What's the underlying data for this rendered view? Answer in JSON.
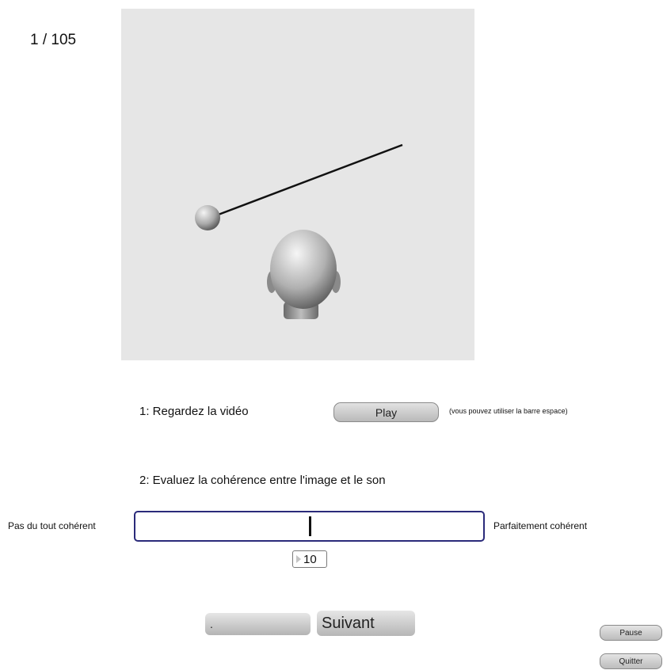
{
  "header": {
    "counter": "1 / 105"
  },
  "steps": {
    "step1_label": "1: Regardez la vidéo",
    "play_label": "Play",
    "play_hint": "(vous pouvez utiliser la barre espace)",
    "step2_label": "2: Evaluez la cohérence entre l'image et le son"
  },
  "rating": {
    "left_label": "Pas du tout cohérent",
    "right_label": "Parfaitement cohérent",
    "value": "10",
    "slider_level": 0.5
  },
  "navigation": {
    "previous_label": ".",
    "next_label": "Suivant"
  },
  "controls": {
    "pause_label": "Pause",
    "quit_label": "Quitter"
  },
  "colors": {
    "video_background": "#e6e6e6",
    "slider_border": "#2a2a7a"
  }
}
